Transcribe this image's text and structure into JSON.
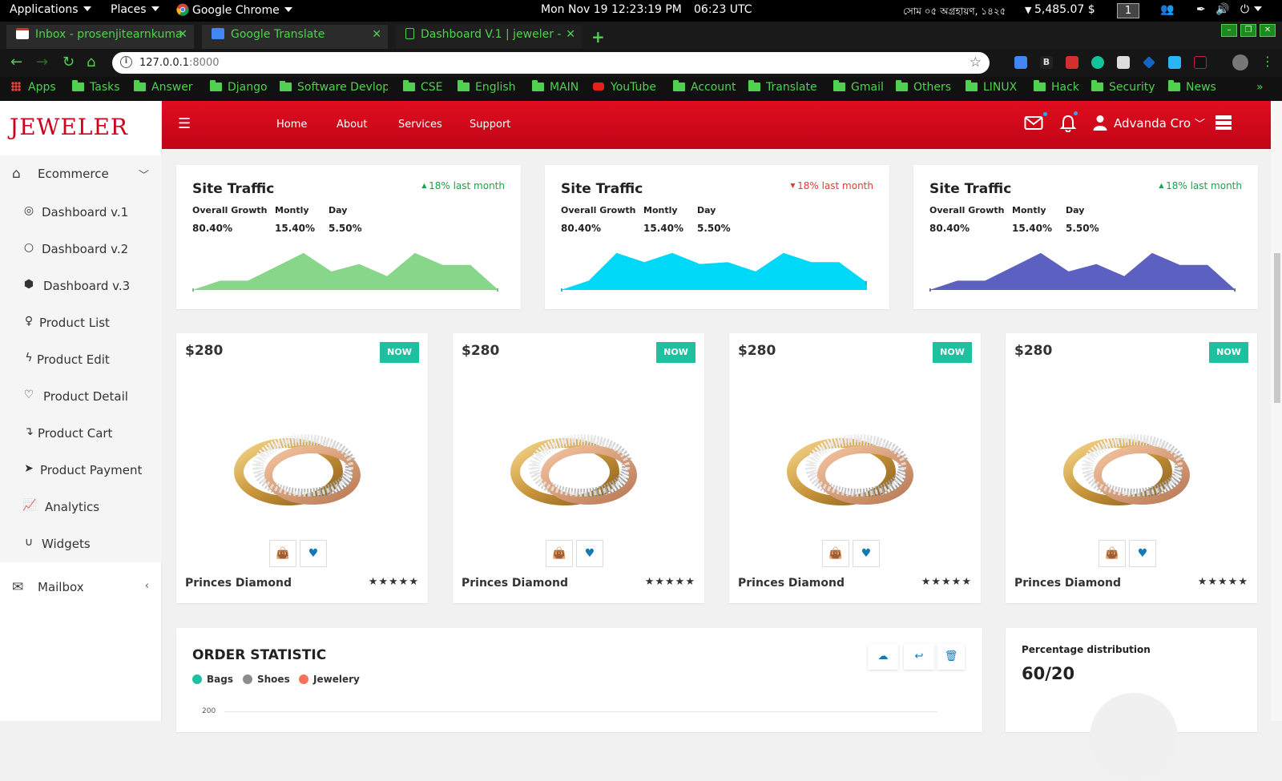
{
  "os_bar": {
    "applications": "Applications",
    "places": "Places",
    "chrome": "Google Chrome",
    "clock": "Mon Nov 19  12:23:19 PM",
    "utc": "06:23 UTC",
    "bangla_date": "সোম ০৫ অগ্রহায়ণ, ১৪২৫",
    "price": "5,485.07 $",
    "workspace": "1"
  },
  "tabs": [
    {
      "label": "Inbox - prosenjitearnkuma",
      "icon": "gmail-icon"
    },
    {
      "label": "Google Translate",
      "icon": "translate-icon"
    },
    {
      "label": "Dashboard V.1 | jeweler -",
      "icon": "page-icon"
    }
  ],
  "address": {
    "host": "127.0.0.1",
    "port": ":8000"
  },
  "bookmarks": {
    "apps": "Apps",
    "items": [
      "Tasks",
      "Answer",
      "Django",
      "Software Devlop",
      "CSE",
      "English",
      "MAIN",
      "YouTube",
      "Account",
      "Translate",
      "Gmail",
      "Others",
      "LINUX",
      "Hack",
      "Security",
      "News"
    ],
    "more": "»"
  },
  "sidebar": {
    "logo": "JEWELER",
    "ecommerce": "Ecommerce",
    "items": [
      {
        "label": "Dashboard v.1",
        "icon": "target-icon"
      },
      {
        "label": "Dashboard v.2",
        "icon": "circle-icon"
      },
      {
        "label": "Dashboard v.3",
        "icon": "cube-icon"
      },
      {
        "label": "Product List",
        "icon": "female-icon"
      },
      {
        "label": "Product Edit",
        "icon": "bolt-icon"
      },
      {
        "label": "Product Detail",
        "icon": "heart-icon"
      },
      {
        "label": "Product Cart",
        "icon": "arrow-down-icon"
      },
      {
        "label": "Product Payment",
        "icon": "send-icon"
      },
      {
        "label": "Analytics",
        "icon": "chart-icon"
      },
      {
        "label": "Widgets",
        "icon": "magnet-icon"
      }
    ],
    "mailbox": "Mailbox"
  },
  "header": {
    "nav": [
      "Home",
      "About",
      "Services",
      "Support"
    ],
    "user": "Advanda Cro"
  },
  "traffic_cards": [
    {
      "title": "Site Traffic",
      "trend": "18% last month",
      "trend_dir": "up",
      "trend_color": "#1aa34a",
      "color": "#88d68a",
      "labels": [
        "Overall Growth",
        "Montly",
        "Day"
      ],
      "values": [
        "80.40%",
        "15.40%",
        "5.50%"
      ],
      "points": [
        0,
        10,
        10,
        25,
        40,
        20,
        28,
        15,
        40,
        27,
        27,
        0
      ]
    },
    {
      "title": "Site Traffic",
      "trend": "18% last month",
      "trend_dir": "down",
      "trend_color": "#e53935",
      "color": "#00d8f7",
      "labels": [
        "Overall Growth",
        "Montly",
        "Day"
      ],
      "values": [
        "80.40%",
        "15.40%",
        "5.50%"
      ],
      "points": [
        0,
        10,
        40,
        30,
        40,
        28,
        30,
        20,
        40,
        30,
        30,
        8
      ]
    },
    {
      "title": "Site Traffic",
      "trend": "18% last month",
      "trend_dir": "up",
      "trend_color": "#1aa34a",
      "color": "#5c60c0",
      "labels": [
        "Overall Growth",
        "Montly",
        "Day"
      ],
      "values": [
        "80.40%",
        "15.40%",
        "5.50%"
      ],
      "points": [
        0,
        10,
        10,
        25,
        40,
        20,
        28,
        15,
        40,
        27,
        27,
        0
      ]
    }
  ],
  "products": [
    {
      "price": "$280",
      "badge": "NOW",
      "name": "Princes Diamond",
      "stars": "★★★★★"
    },
    {
      "price": "$280",
      "badge": "NOW",
      "name": "Princes Diamond",
      "stars": "★★★★★"
    },
    {
      "price": "$280",
      "badge": "NOW",
      "name": "Princes Diamond",
      "stars": "★★★★★"
    },
    {
      "price": "$280",
      "badge": "NOW",
      "name": "Princes Diamond",
      "stars": "★★★★★"
    }
  ],
  "order_stat": {
    "title": "ORDER STATISTIC",
    "legend": [
      {
        "label": "Bags",
        "color": "#1fc0a0"
      },
      {
        "label": "Shoes",
        "color": "#8c8c8c"
      },
      {
        "label": "Jewelery",
        "color": "#f5735b"
      }
    ],
    "axis_top": "200"
  },
  "distribution": {
    "title": "Percentage distribution",
    "value": "60/20"
  }
}
